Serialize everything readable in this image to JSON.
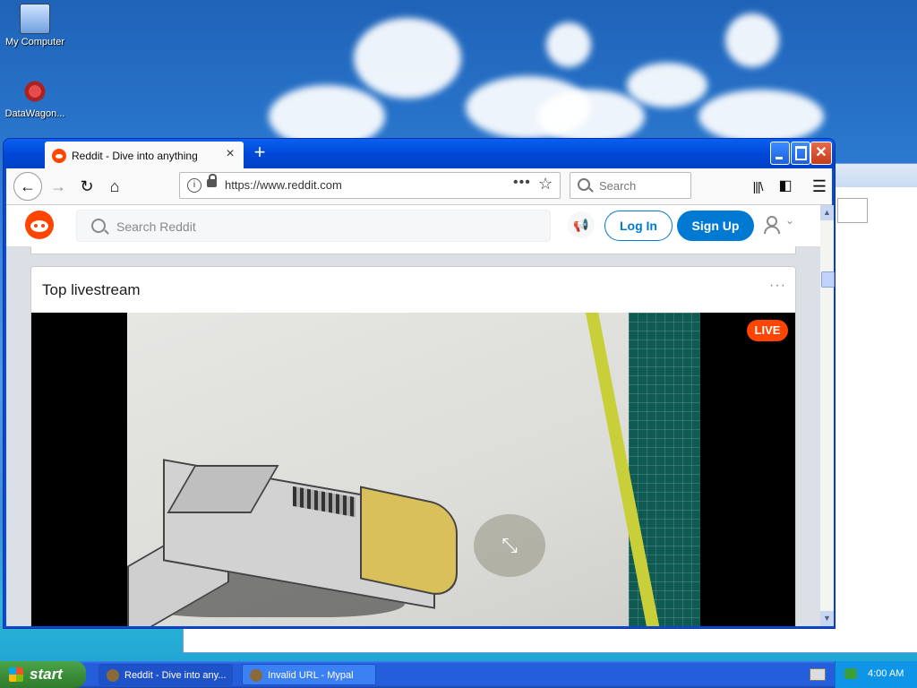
{
  "desktop": {
    "icons": [
      {
        "label": "My Computer"
      },
      {
        "label": "DataWagon..."
      }
    ]
  },
  "browser": {
    "tab_title": "Reddit - Dive into anything",
    "tab_close": "×",
    "new_tab": "+",
    "url": "https://www.reddit.com",
    "search_placeholder": "Search",
    "page_actions": "•••"
  },
  "reddit": {
    "search_placeholder": "Search Reddit",
    "login_label": "Log In",
    "signup_label": "Sign Up",
    "card_title": "Top livestream",
    "card_menu": "···",
    "live_badge": "LIVE"
  },
  "taskbar": {
    "start_label": "start",
    "tasks": [
      {
        "label": "Reddit - Dive into any..."
      },
      {
        "label": "Invalid URL - Mypal"
      }
    ],
    "clock": "4:00 AM"
  },
  "colors": {
    "reddit_orange": "#ff4500",
    "reddit_blue": "#0079d3",
    "xp_title_blue": "#0a5ff2",
    "start_green": "#3c8f3a"
  }
}
